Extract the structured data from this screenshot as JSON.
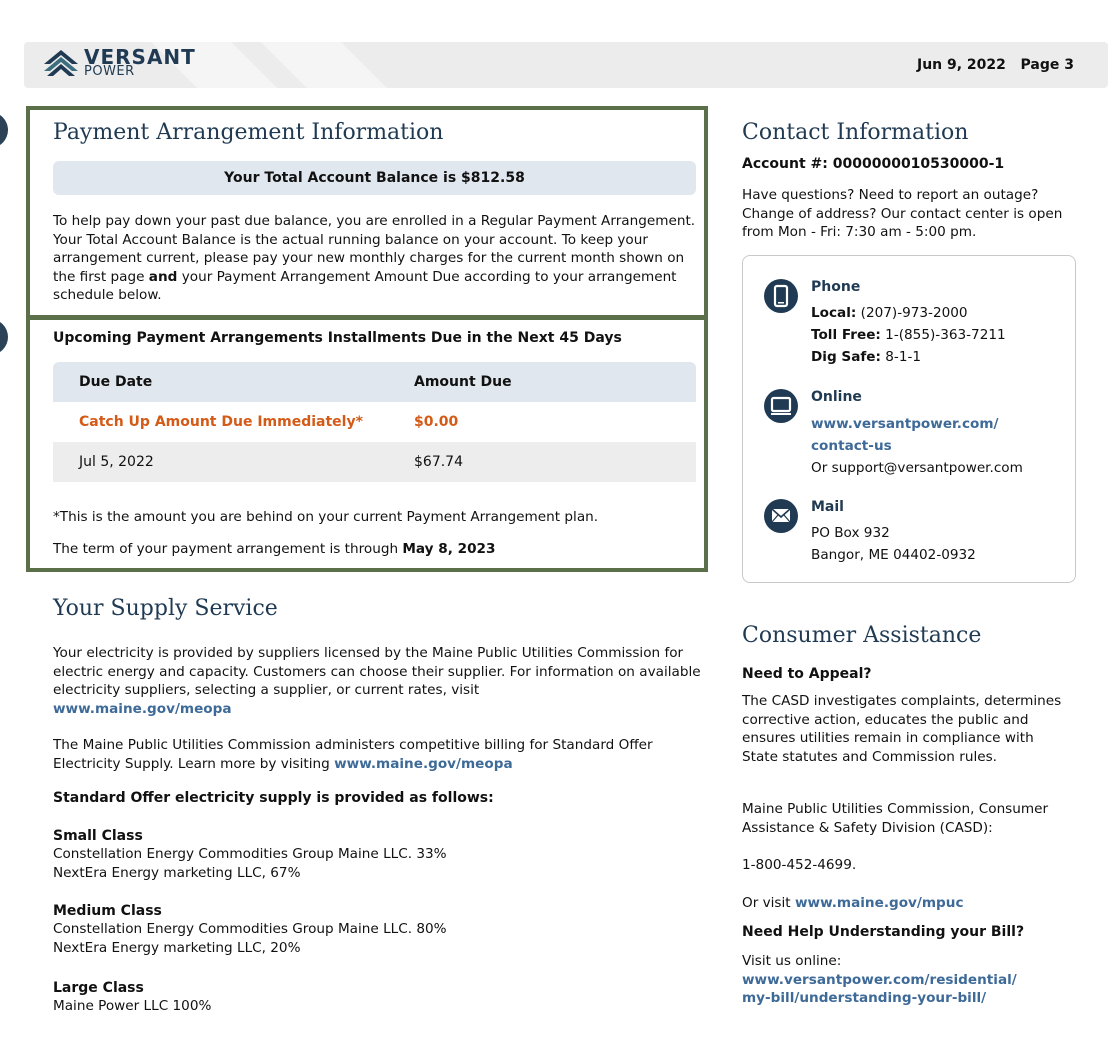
{
  "header": {
    "logo_name": "VERSANT",
    "logo_sub": "POWER",
    "date_page": "Jun 9, 2022   Page 3"
  },
  "payment_arrangement": {
    "title": "Payment Arrangement Information",
    "balance_text": "Your Total Account Balance is $812.58",
    "para_part1": "To help pay down your past due balance, you are enrolled in a Regular Payment Arrangement. Your Total Account Balance is the actual running balance on your account. To keep your arrangement current, please pay your new monthly charges for the current month shown on the first page ",
    "para_bold": "and",
    "para_part2": " your Payment Arrangement Amount Due according to your arrangement schedule below."
  },
  "installments": {
    "title": "Upcoming Payment Arrangements Installments Due in the Next 45 Days",
    "col_due_date": "Due Date",
    "col_amount": "Amount Due",
    "rows": [
      {
        "label": "Catch Up Amount Due Immediately*",
        "amount": "$0.00"
      },
      {
        "label": "Jul 5, 2022",
        "amount": "$67.74"
      }
    ],
    "note": "*This is the amount you are behind on your current Payment Arrangement plan.",
    "term_text": "The term of your payment arrangement is through ",
    "term_date": "May 8, 2023"
  },
  "supply": {
    "title": "Your Supply Service",
    "p1_text": "Your electricity is provided by suppliers licensed by the Maine Public Utilities Commission for electric energy and capacity. Customers can choose their supplier. For information on available electricity suppliers, selecting a supplier, or current rates, visit",
    "p1_link": "www.maine.gov/meopa",
    "p2_text": "The Maine Public Utilities Commission administers competitive billing for Standard Offer Electricity Supply. Learn more by visiting ",
    "p2_link": "www.maine.gov/meopa",
    "provided_heading": "Standard Offer electricity supply is provided as follows:",
    "classes": [
      {
        "name": "Small Class",
        "lines": [
          "Constellation Energy Commodities Group Maine LLC. 33%",
          "NextEra Energy marketing LLC, 67%"
        ]
      },
      {
        "name": "Medium Class",
        "lines": [
          "Constellation Energy Commodities Group Maine LLC. 80%",
          "NextEra Energy marketing LLC, 20%"
        ]
      },
      {
        "name": "Large Class",
        "lines": [
          "Maine Power LLC 100%"
        ]
      }
    ]
  },
  "contact": {
    "title": "Contact Information",
    "account": "Account #: 0000000010530000-1",
    "intro": "Have questions? Need to report an outage? Change of address? Our contact center is open from Mon - Fri: 7:30 am - 5:00 pm.",
    "phone_heading": "Phone",
    "local_label": "Local:",
    "local_value": " (207)-973-2000",
    "tollfree_label": "Toll Free:",
    "tollfree_value": " 1-(855)-363-7211",
    "digsafe_label": "Dig Safe:",
    "digsafe_value": " 8-1-1",
    "online_heading": "Online",
    "online_link1": "www.versantpower.com/",
    "online_link2": "contact-us",
    "online_alt": "Or support@versantpower.com",
    "mail_heading": "Mail",
    "mail_line1": "PO Box 932",
    "mail_line2": "Bangor, ME 04402-0932"
  },
  "consumer": {
    "title": "Consumer Assistance",
    "appeal_heading": "Need to Appeal?",
    "appeal_text": "The CASD investigates complaints, determines corrective action, educates the public and ensures utilities remain in compliance with State statutes and Commission rules.",
    "commission_text": "Maine Public Utilities Commission, Consumer Assistance & Safety Division (CASD):",
    "phone": "1-800-452-4699.",
    "visit_prefix": "Or visit ",
    "visit_link": "www.maine.gov/mpuc",
    "help_heading": "Need Help Understanding your Bill?",
    "help_text": "Visit us online:",
    "help_link1": "www.versantpower.com/residential/",
    "help_link2": "my-bill/understanding-your-bill/"
  },
  "colors": {
    "brand_navy": "#1f3a52",
    "box_border_green": "#5b7049",
    "catch_up_orange": "#d45a17",
    "link_blue": "#3e6a98"
  },
  "icons": [
    "versant-logo-icon",
    "phone-icon",
    "monitor-icon",
    "mail-icon"
  ]
}
